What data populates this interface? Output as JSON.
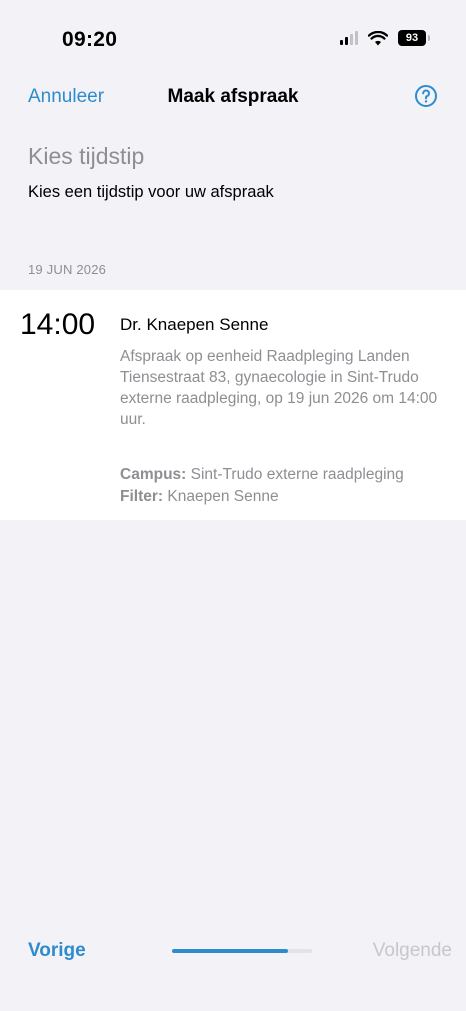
{
  "status_bar": {
    "time": "09:20",
    "battery": "93"
  },
  "nav": {
    "cancel_label": "Annuleer",
    "title": "Maak afspraak",
    "help_icon": "question-circle-icon"
  },
  "section": {
    "title": "Kies tijdstip",
    "subtitle": "Kies een tijdstip voor uw afspraak"
  },
  "date_header": "19 JUN 2026",
  "slot": {
    "time": "14:00",
    "doctor": "Dr. Knaepen Senne",
    "description": "Afspraak op eenheid Raadpleging Landen Tiensestraat 83, gynaecologie in Sint-Trudo externe raadpleging, op 19 jun 2026 om 14:00 uur.",
    "campus_label": "Campus:",
    "campus_value": "Sint-Trudo externe raadpleging",
    "filter_label": "Filter:",
    "filter_value": "Knaepen Senne"
  },
  "footer": {
    "prev_label": "Vorige",
    "next_label": "Volgende",
    "progress": 0.83
  },
  "colors": {
    "accent": "#2e8ccd",
    "secondary_text": "#8e8e93",
    "background": "#f2f2f7"
  }
}
